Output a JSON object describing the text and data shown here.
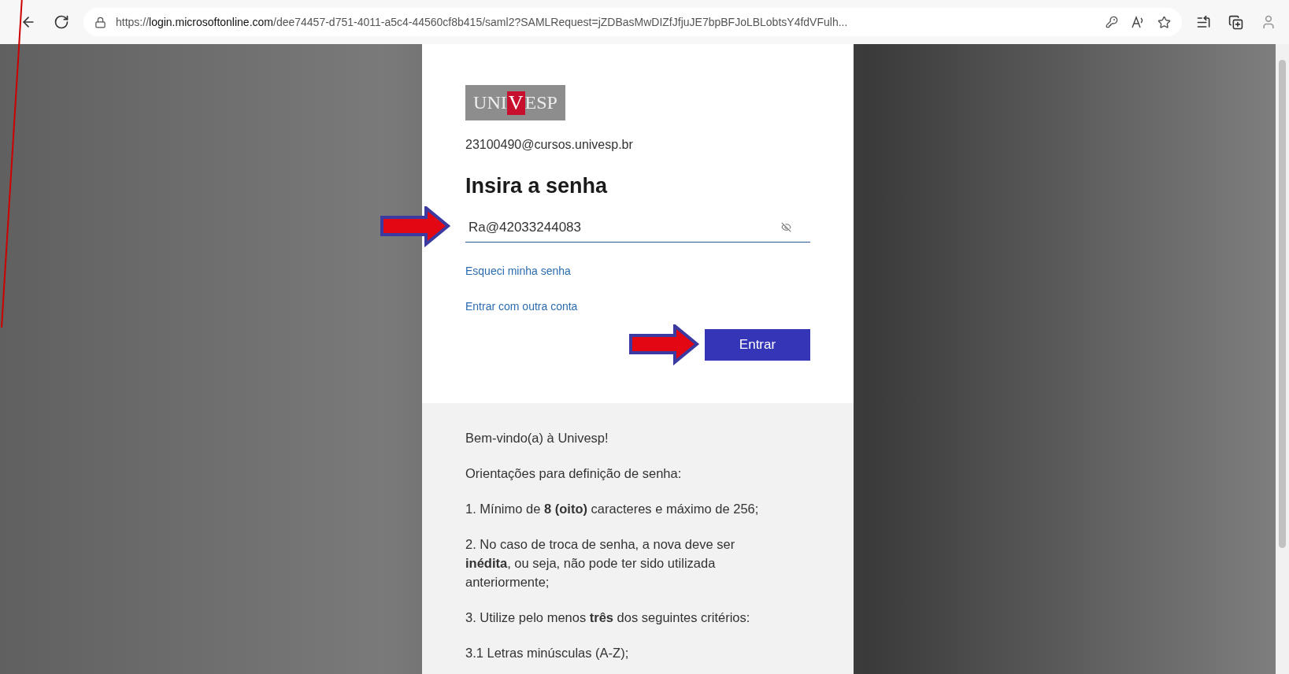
{
  "browser": {
    "address": "https://**login.microsoftonline.com**/dee74457-d751-4011-a5c4-44560cf8b415/saml2?SAMLRequest=jZDBasMwDIZfJfjuJE7bpBFJoLBLobtsY4fdVFulh..."
  },
  "login": {
    "logo": {
      "left": "UNI",
      "mark": "V",
      "right": "ESP"
    },
    "account": "23100490@cursos.univesp.br",
    "title": "Insira a senha",
    "password": {
      "value": "Ra@42033244083",
      "annotated": true
    },
    "links": [
      "Esqueci minha senha",
      "Entrar com outra conta"
    ],
    "submit": {
      "label": "Entrar",
      "annotated": true
    }
  },
  "instructions": [
    "Bem-vindo(a) à Univesp!",
    "Orientações para definição de senha:",
    "1. Mínimo de **8 (oito)** caracteres e máximo de 256;",
    "2. No caso de troca de senha, a nova deve ser **inédita**, ou seja, não pode ter sido utilizada anteriormente;",
    "3. Utilize pelo menos **três** dos seguintes critérios:",
    "3.1 Letras minúsculas (A-Z);"
  ]
}
